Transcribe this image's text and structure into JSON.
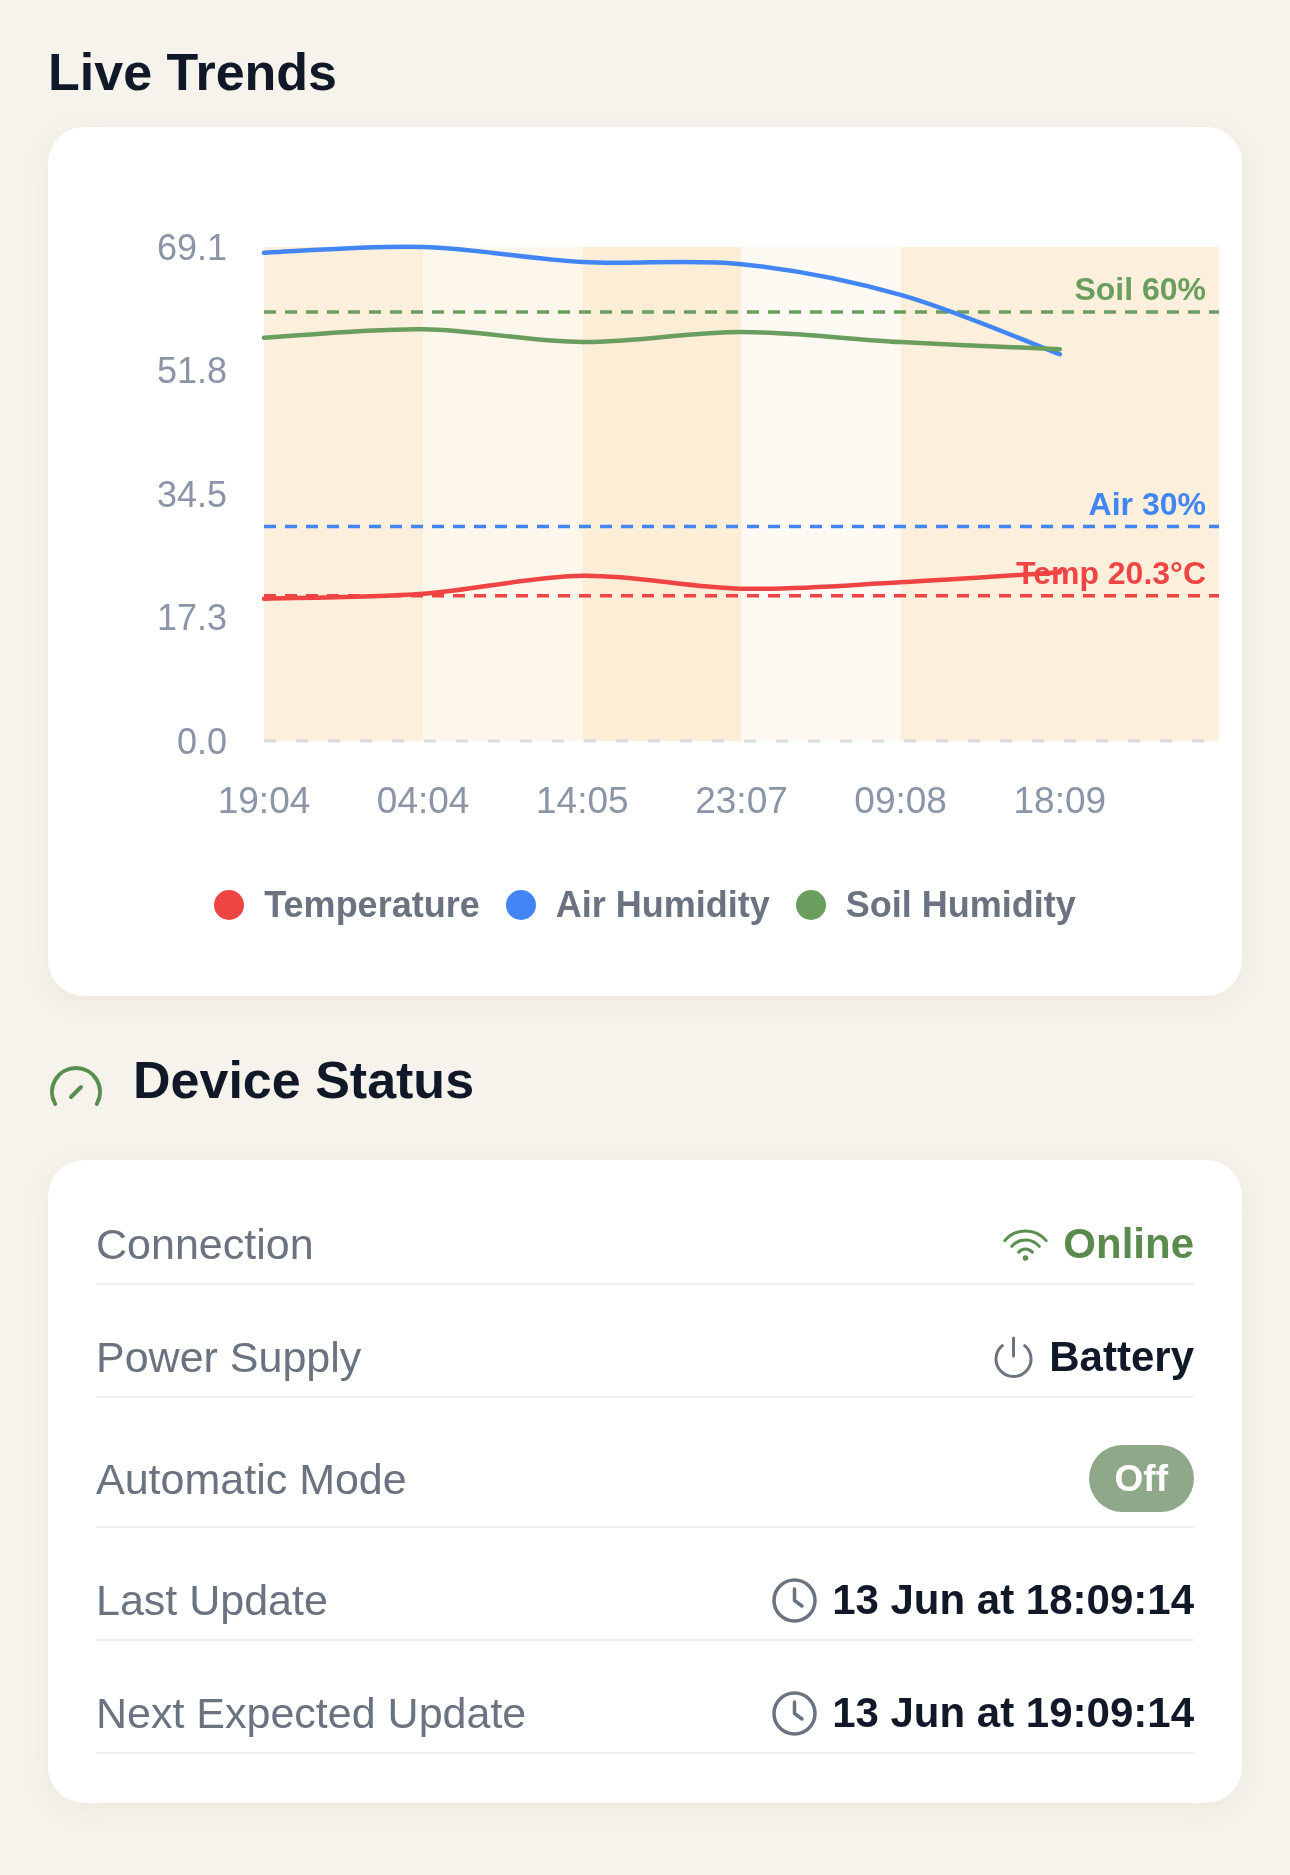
{
  "live_trends": {
    "title": "Live Trends",
    "chart_data": {
      "type": "line",
      "categories": [
        "19:04",
        "04:04",
        "14:05",
        "23:07",
        "09:08",
        "18:09"
      ],
      "ylim": [
        0,
        69.1
      ],
      "yticks": [
        {
          "value": 0,
          "label": "0.0"
        },
        17.3,
        34.5,
        51.8,
        69.1
      ],
      "series": [
        {
          "name": "Temperature",
          "color": "#ef4444",
          "values": [
            19.9,
            20.6,
            23.1,
            21.3,
            22.2,
            23.6
          ]
        },
        {
          "name": "Air Humidity",
          "color": "#4285f4",
          "values": [
            68.3,
            69.1,
            67.0,
            66.7,
            62.4,
            54.1
          ]
        },
        {
          "name": "Soil Humidity",
          "color": "#6a9e5e",
          "values": [
            56.4,
            57.6,
            55.8,
            57.2,
            55.8,
            54.8
          ]
        }
      ],
      "ref_lines": [
        {
          "axis": "y",
          "value": 60,
          "label": "Soil 60%",
          "color": "#6a9e5e"
        },
        {
          "axis": "y",
          "value": 30,
          "label": "Air 30%",
          "color": "#4285f4"
        },
        {
          "axis": "y",
          "value": 20.3,
          "label": "Temp 20.3°C",
          "color": "#ef4444"
        }
      ],
      "bands": [
        {
          "axis": "x",
          "from": "19:04",
          "to": "04:04",
          "color": "#fcf0dd"
        },
        {
          "axis": "x",
          "from": "04:04",
          "to": "14:05",
          "color": "#fdf6ea"
        },
        {
          "axis": "x",
          "from": "14:05",
          "to": "23:07",
          "color": "#fcedd7"
        },
        {
          "axis": "x",
          "from": "23:07",
          "to": "09:08",
          "color": "#fefaf3"
        }
      ],
      "legend": "bottom"
    }
  },
  "device_status": {
    "title": "Device Status",
    "rows": [
      {
        "kind": "connection",
        "label": "Connection",
        "value": "Online",
        "connected": true
      },
      {
        "kind": "power",
        "label": "Power Supply",
        "value": "Battery"
      },
      {
        "kind": "toggle",
        "label": "Automatic Mode",
        "value": "Off",
        "on": false
      },
      {
        "kind": "time",
        "label": "Last Update",
        "value": "13 Jun at 18:09:14"
      },
      {
        "kind": "time",
        "label": "Next Expected Update",
        "value": "13 Jun at 19:09:14"
      }
    ]
  }
}
